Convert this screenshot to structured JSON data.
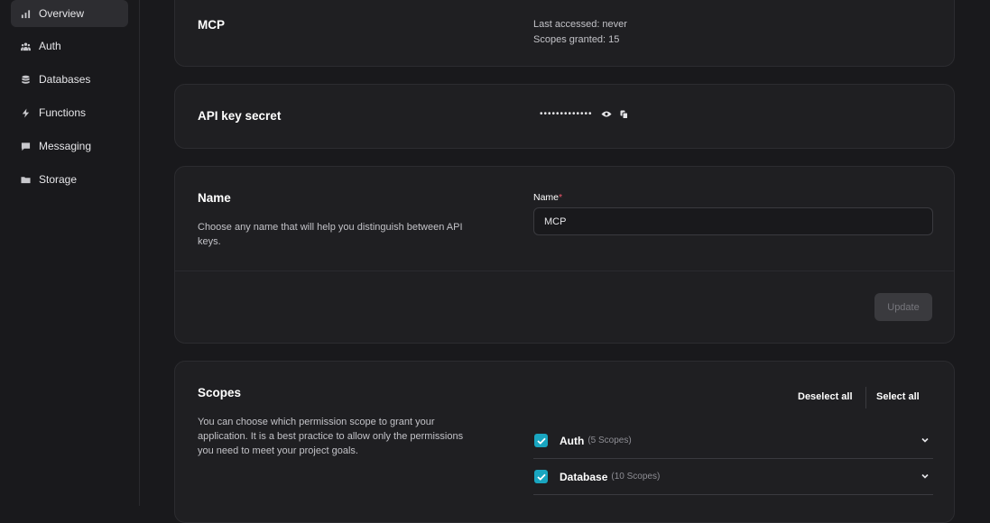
{
  "sidebar": {
    "items": [
      {
        "label": "Overview",
        "icon": "bar-chart-icon",
        "active": true
      },
      {
        "label": "Auth",
        "icon": "users-icon",
        "active": false
      },
      {
        "label": "Databases",
        "icon": "database-icon",
        "active": false
      },
      {
        "label": "Functions",
        "icon": "lightning-icon",
        "active": false
      },
      {
        "label": "Messaging",
        "icon": "chat-icon",
        "active": false
      },
      {
        "label": "Storage",
        "icon": "folder-icon",
        "active": false
      }
    ]
  },
  "overview_card": {
    "title": "MCP",
    "last_accessed": "Last accessed: never",
    "scopes_granted": "Scopes granted: 15"
  },
  "secret_card": {
    "title": "API key secret",
    "masked_value": "•••••••••••••",
    "reveal_icon": "eye-icon",
    "copy_icon": "copy-icon"
  },
  "name_card": {
    "title": "Name",
    "description": "Choose any name that will help you distinguish between API keys.",
    "field_label": "Name",
    "required_marker": "*",
    "field_value": "MCP",
    "update_label": "Update"
  },
  "scopes_card": {
    "title": "Scopes",
    "description": "You can choose which permission scope to grant your application. It is a best practice to allow only the permissions you need to meet your project goals.",
    "deselect_all": "Deselect all",
    "select_all": "Select all",
    "groups": [
      {
        "name": "Auth",
        "count": "(5 Scopes)",
        "checked": true
      },
      {
        "name": "Database",
        "count": "(10 Scopes)",
        "checked": true
      }
    ]
  },
  "colors": {
    "accent": "#19a5c0",
    "required": "#f0556a",
    "background": "#19191c",
    "card": "#1f1f22"
  }
}
